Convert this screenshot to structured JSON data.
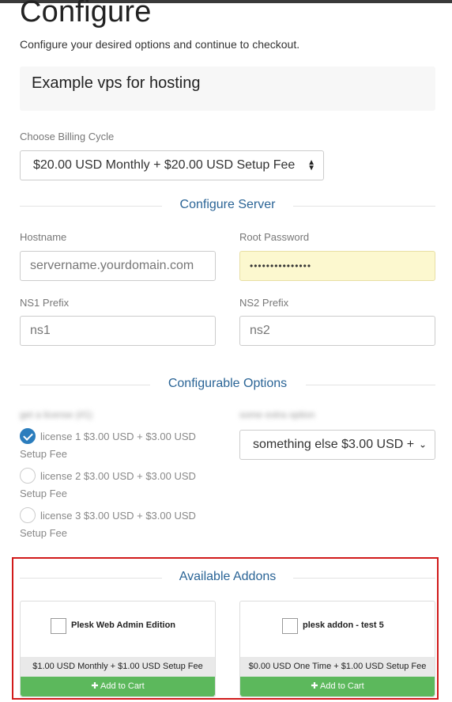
{
  "page": {
    "title": "Configure",
    "subtitle": "Configure your desired options and continue to checkout."
  },
  "product": {
    "name": "Example vps for hosting"
  },
  "billing": {
    "label": "Choose Billing Cycle",
    "selected": "$20.00 USD Monthly + $20.00 USD Setup Fee"
  },
  "configure_server": {
    "heading": "Configure Server",
    "hostname_label": "Hostname",
    "hostname_placeholder": "servername.yourdomain.com",
    "root_password_label": "Root Password",
    "root_password_value": "•••••••••••••••",
    "ns1_label": "NS1 Prefix",
    "ns1_value": "ns1",
    "ns2_label": "NS2 Prefix",
    "ns2_value": "ns2"
  },
  "configurable_options": {
    "heading": "Configurable Options",
    "left_label_blurred": "get a license (#1)",
    "right_label_blurred": "some extra option",
    "licenses": [
      {
        "label": "license 1 $3.00 USD + $3.00 USD",
        "suffix": "Setup Fee",
        "checked": true
      },
      {
        "label": "license 2 $3.00 USD + $3.00 USD",
        "suffix": "Setup Fee",
        "checked": false
      },
      {
        "label": "license 3 $3.00 USD + $3.00 USD",
        "suffix": "Setup Fee",
        "checked": false
      }
    ],
    "right_select": "something else $3.00 USD +"
  },
  "addons": {
    "heading": "Available Addons",
    "items": [
      {
        "name": "Plesk Web Admin Edition",
        "price": "$1.00 USD Monthly + $1.00 USD Setup Fee",
        "button": "Add to Cart"
      },
      {
        "name": "plesk addon - test 5",
        "price": "$0.00 USD One Time + $1.00 USD Setup Fee",
        "button": "Add to Cart"
      }
    ]
  },
  "colors": {
    "accent": "#2a6496",
    "checked": "#2b7dbd",
    "add_to_cart": "#5cb85c",
    "highlight_border": "#d11a1a",
    "password_bg": "#fcf8cf"
  }
}
